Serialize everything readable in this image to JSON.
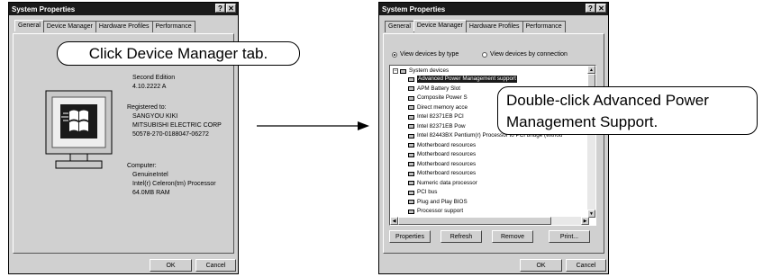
{
  "window_a": {
    "title": "System Properties",
    "title_buttons": [
      "?",
      "✕"
    ],
    "tabs": [
      "General",
      "Device Manager",
      "Hardware Profiles",
      "Performance"
    ],
    "system_lines": [
      "Second Edition",
      "4.10.2222 A"
    ],
    "registered_label": "Registered to:",
    "registered_lines": [
      "SANGYOU KIKI",
      "MITSUBISHI ELECTRIC CORP",
      "50578-270-0188047-06272"
    ],
    "computer_label": "Computer:",
    "computer_lines": [
      "GenuineIntel",
      "Intel(r) Celeron(tm) Processor",
      "64.0MB RAM"
    ],
    "ok": "OK",
    "cancel": "Cancel"
  },
  "window_b": {
    "title": "System Properties",
    "title_buttons": [
      "?",
      "✕"
    ],
    "tabs": [
      "General",
      "Device Manager",
      "Hardware Profiles",
      "Performance"
    ],
    "view_by_type": "View devices by type",
    "view_by_connection": "View devices by connection",
    "tree_root": "System devices",
    "devices": [
      "Advanced Power Management support",
      "APM Battery Slot",
      "Composite Power S",
      "Direct memory acce",
      "Intel 82371EB PCI",
      "Intel 82371EB Pow",
      "Intel 82443BX Pentium(r) Processor to PCI bridge (withou",
      "Motherboard resources",
      "Motherboard resources",
      "Motherboard resources",
      "Motherboard resources",
      "Numeric data processor",
      "PCI bus",
      "Plug and Play BIOS",
      "Processor support"
    ],
    "buttons": [
      "Properties",
      "Refresh",
      "Remove",
      "Print..."
    ],
    "ok": "OK",
    "cancel": "Cancel"
  },
  "callout_a": "Click Device Manager tab.",
  "callout_b_line1": "Double-click Advanced Power",
  "callout_b_line2": "Management Support."
}
